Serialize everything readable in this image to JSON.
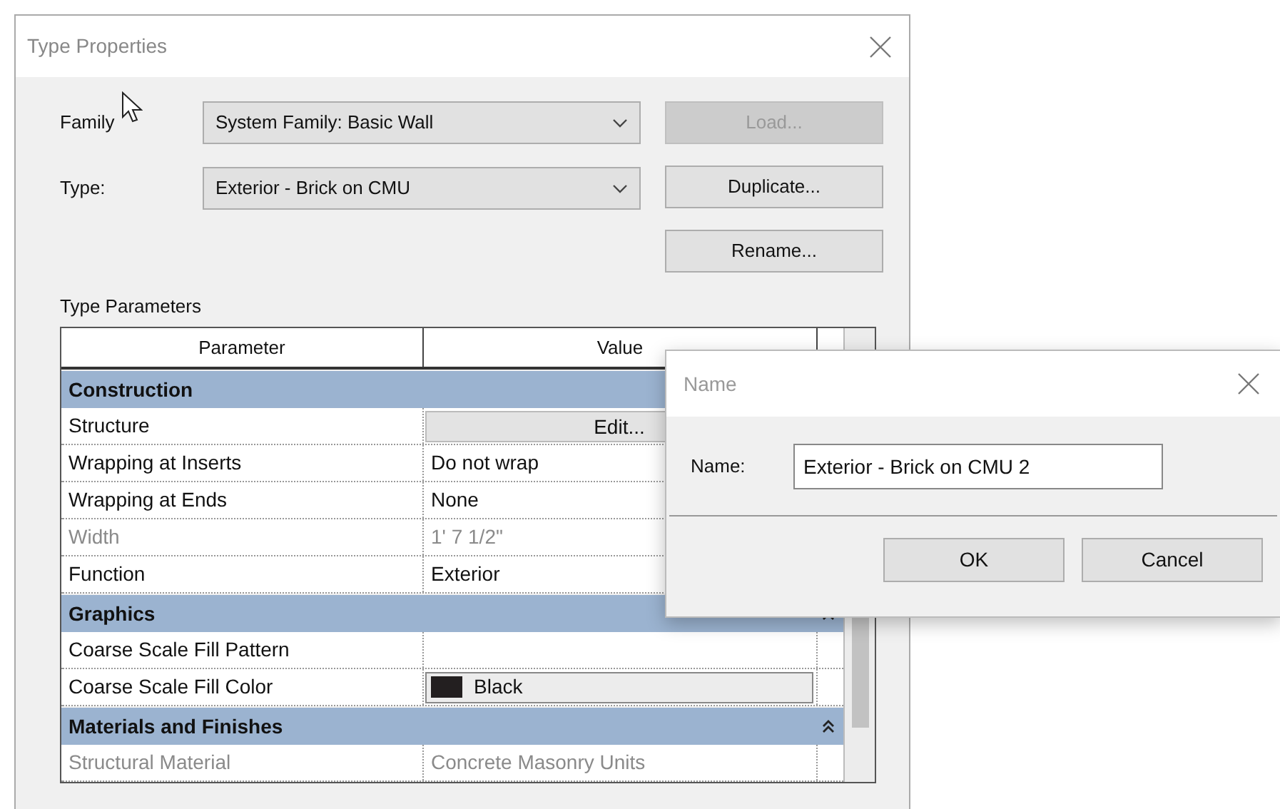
{
  "window": {
    "title": "Type Properties"
  },
  "fields": [
    {
      "label": "Family",
      "value": "System Family: Basic Wall"
    },
    {
      "label": "Type:",
      "value": "Exterior - Brick on CMU"
    }
  ],
  "buttons": [
    {
      "label": "Load...",
      "disabled": true
    },
    {
      "label": "Duplicate...",
      "disabled": false
    },
    {
      "label": "Rename...",
      "disabled": false
    }
  ],
  "section_title": "Type Parameters",
  "table": {
    "columns": [
      "Parameter",
      "Value"
    ],
    "rows": [
      {
        "kind": "group",
        "label": "Construction"
      },
      {
        "kind": "button",
        "label": "Structure",
        "value": "Edit...",
        "disabled": false
      },
      {
        "kind": "text",
        "label": "Wrapping at Inserts",
        "value": "Do not wrap",
        "disabled": false
      },
      {
        "kind": "text",
        "label": "Wrapping at Ends",
        "value": "None",
        "disabled": false
      },
      {
        "kind": "text",
        "label": "Width",
        "value": "1'  7 1/2\"",
        "disabled": true
      },
      {
        "kind": "text",
        "label": "Function",
        "value": "Exterior",
        "disabled": false
      },
      {
        "kind": "group",
        "label": "Graphics",
        "collapse_icon": true
      },
      {
        "kind": "text",
        "label": "Coarse Scale Fill Pattern",
        "disabled": false
      },
      {
        "kind": "color",
        "label": "Coarse Scale Fill Color",
        "value": "Black",
        "color": "#231f20",
        "disabled": false
      },
      {
        "kind": "group",
        "label": "Materials and Finishes",
        "collapse_icon": true
      },
      {
        "kind": "text",
        "label": "Structural Material",
        "value": "Concrete Masonry Units",
        "disabled": true
      }
    ]
  },
  "name_dialog": {
    "title": "Name",
    "label": "Name:",
    "value": "Exterior - Brick on CMU 2",
    "buttons": [
      "OK",
      "Cancel"
    ]
  }
}
